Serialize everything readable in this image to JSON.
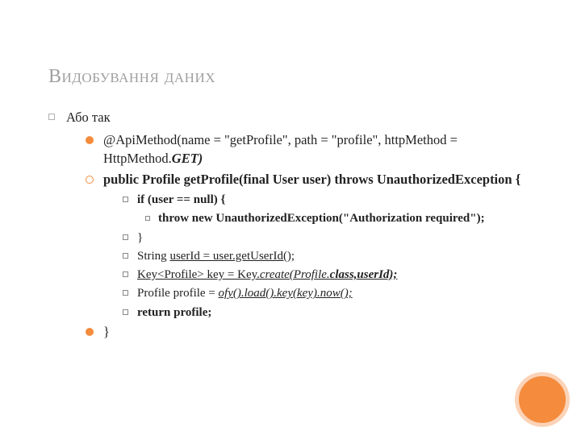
{
  "title": "Видобування даних",
  "lvl1": "Або так",
  "ann_plain": "@ApiMethod(name = \"getProfile\", path = \"profile\", httpMethod = HttpMethod.",
  "ann_ital": "GET)",
  "sig": "public Profile getProfile(final User user) throws UnauthorizedException {",
  "ifline": "if (user == null) {",
  "throwline": "throw new UnauthorizedException(\"Authorization required\");",
  "closebrace": "}",
  "uid_a": "String ",
  "uid_b": "userId = user.getUserId();",
  "key_a": "Key",
  "key_b": "<Profile> key = Key.",
  "key_c": "create(Profile.",
  "key_d": "class,userId);",
  "prof_a": "Profile profile = ",
  "prof_b": "ofy().load().key(key).now();",
  "ret": "return profile;",
  "end": "}"
}
